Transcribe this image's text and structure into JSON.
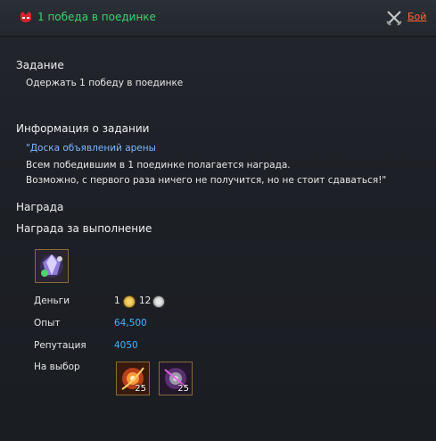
{
  "header": {
    "title": "1 победа в поединке",
    "battle_link": "Бой"
  },
  "task": {
    "heading": "Задание",
    "text": "Одержать 1 победу в поединке"
  },
  "info": {
    "heading": "Информация о задании",
    "quote_open": "\"",
    "source_link": "Доска объявлений арены",
    "line1": "Всем победившим в 1 поединке полагается награда.",
    "line2": "Возможно, с первого раза ничего не получится, но не стоит сдаваться!\""
  },
  "reward": {
    "heading": "Награда",
    "completion_heading": "Награда за выполнение",
    "money_label": "Деньги",
    "money_gold": "1",
    "money_silver": "12",
    "exp_label": "Опыт",
    "exp_value": "64,500",
    "rep_label": "Репутация",
    "rep_value": "4050",
    "choice_label": "На выбор",
    "choice_items": [
      {
        "icon": "fire-orb-icon",
        "count": "25"
      },
      {
        "icon": "shadow-orb-icon",
        "count": "25"
      }
    ],
    "main_item_icon": "crystal-gem-icon"
  },
  "colors": {
    "title_green": "#3dd36a",
    "link_orange": "#ff6a3a",
    "value_cyan": "#3fb7ff",
    "source_blue": "#7fb7ff"
  }
}
